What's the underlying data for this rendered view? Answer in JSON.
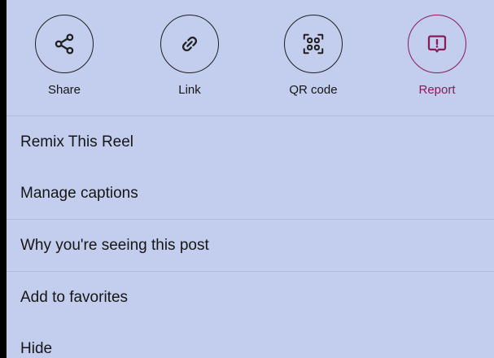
{
  "actions": [
    {
      "label": "Share",
      "icon": "share-icon"
    },
    {
      "label": "Link",
      "icon": "link-icon"
    },
    {
      "label": "QR code",
      "icon": "qr-code-icon"
    },
    {
      "label": "Report",
      "icon": "report-icon"
    }
  ],
  "menu": {
    "items": [
      {
        "label": "Remix This Reel"
      },
      {
        "label": "Manage captions"
      },
      {
        "label": "Why you're seeing this post"
      },
      {
        "label": "Add to favorites"
      },
      {
        "label": "Hide"
      }
    ]
  },
  "colors": {
    "sheet_background": "#c3cded",
    "text": "#161616",
    "report_accent": "#8b1a5a",
    "divider": "#b1bcdc"
  }
}
